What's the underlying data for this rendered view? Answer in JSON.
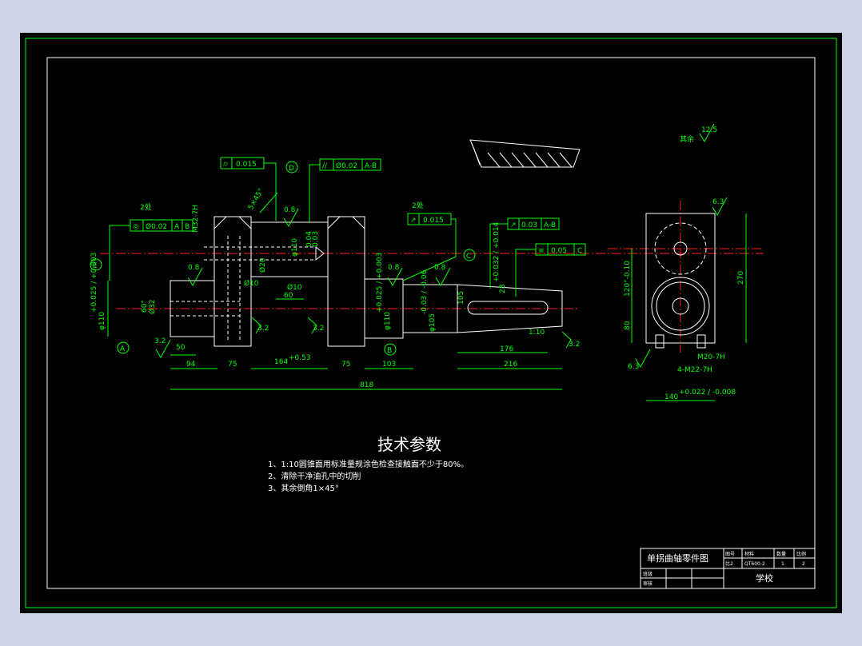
{
  "notes": {
    "title": "技术参数",
    "items": [
      "1、1:10圆锥面用标准量规涂色检查接触面不少于80%。",
      "2、清除干净油孔中的切削",
      "3、其余倒角1×45°"
    ]
  },
  "roughness_note": {
    "label": "其余",
    "value": "12.5"
  },
  "callouts": {
    "two_places_left": "2处",
    "two_places_mid": "2处",
    "thread_m32": "M32-7H",
    "thread_m20": "M20-7H",
    "thread_4m22": "4-M22-7H",
    "taper": "1:10",
    "angle": "60°"
  },
  "fcf": {
    "f1": [
      "⌭",
      "0.015"
    ],
    "f2": [
      "//",
      "Ø0.02",
      "A-B"
    ],
    "f3": [
      "◎",
      "Ø0.02",
      "A",
      "B"
    ],
    "f4": [
      "↗",
      "0.015"
    ],
    "f5": [
      "↗",
      "0.03",
      "A-B"
    ],
    "f6": [
      "≡",
      "0.05",
      "C"
    ]
  },
  "datums": [
    "A",
    "B",
    "C",
    "D",
    "E"
  ],
  "roughness": [
    "0.8",
    "0.8",
    "0.8",
    "0.8",
    "3.2",
    "3.2",
    "3.2",
    "6.3",
    "6.3",
    "3.2"
  ],
  "dimensions": {
    "d818": "818",
    "d94": "94",
    "d75a": "75",
    "d164": "164",
    "d164_tol": "+0.53",
    "d75b": "75",
    "d103": "103",
    "d216": "216",
    "d176": "176",
    "d50": "50",
    "d60": "60",
    "d270": "270",
    "d120": "120°-0.10",
    "d80": "80",
    "d105": "105",
    "d140": "140",
    "d140_tol": "+0.022 / -0.008",
    "phi110a": "φ110",
    "phi110a_tol": "+0.025 / +0.003",
    "phi110b": "φ110",
    "phi110b_tol": "+0.025 / +0.003",
    "phi105": "φ105",
    "phi105_tol": "-0.03 / -0.06",
    "phi10a": "Ø10",
    "phi10b": "Ø10",
    "phi20": "Ø20",
    "phi32": "Ø32",
    "phi110c": "φ110",
    "d28": "28",
    "d28_tol": "+0.032 / +0.014",
    "d5x45": "5×45°",
    "d0_04": "0.04",
    "d0_03": "0.03"
  },
  "title_block": {
    "drawing_name": "单拐曲轴零件图",
    "school": "学校",
    "cells": [
      "图号",
      "材料",
      "数量",
      "比例",
      "比2",
      "QT600-2",
      "1",
      "2",
      "班级",
      "审核"
    ]
  }
}
